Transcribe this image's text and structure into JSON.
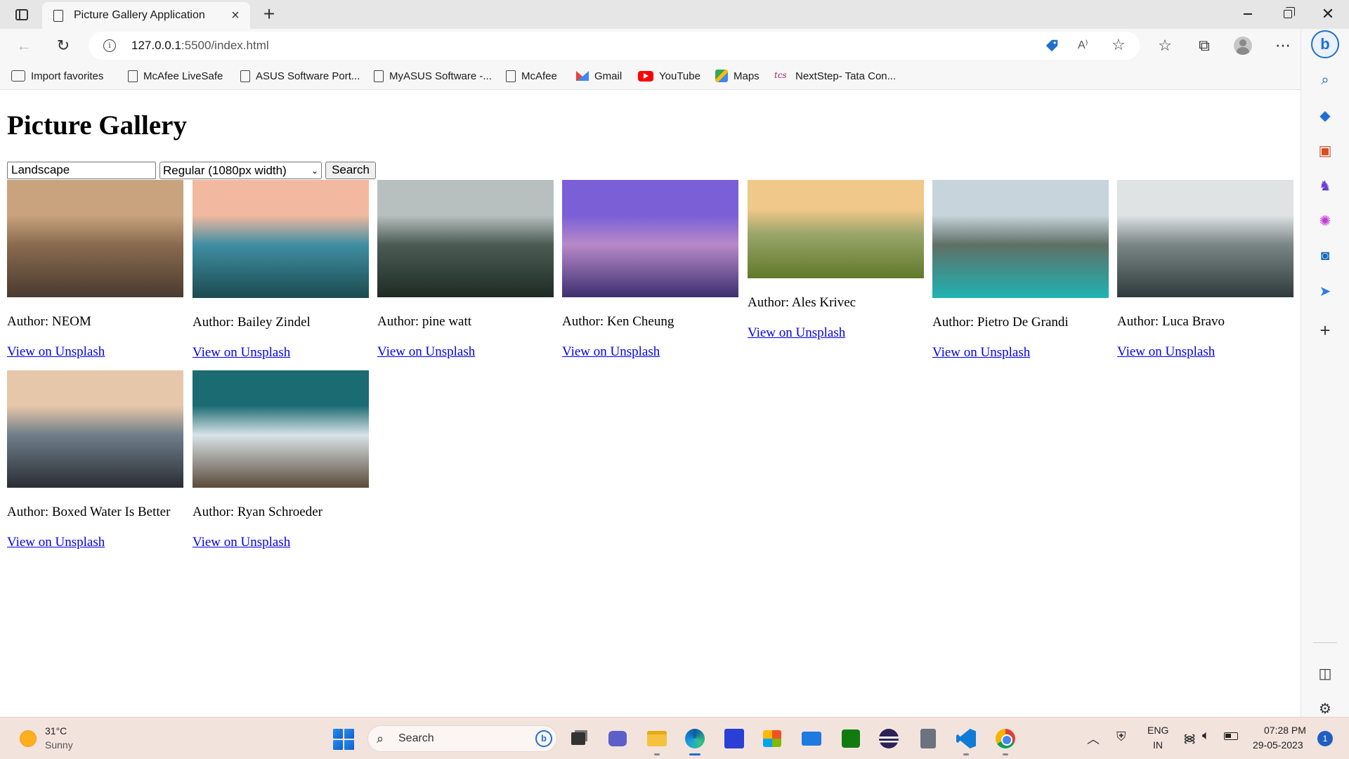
{
  "browser": {
    "tab_title": "Picture Gallery Application",
    "url_host": "127.0.0.1",
    "url_rest": ":5500/index.html",
    "favorites": [
      {
        "label": "Import favorites",
        "icon": "import-icon"
      },
      {
        "label": "McAfee LiveSafe",
        "icon": "page-icon"
      },
      {
        "label": "ASUS Software Port...",
        "icon": "page-icon"
      },
      {
        "label": "MyASUS Software -...",
        "icon": "page-icon"
      },
      {
        "label": "McAfee",
        "icon": "page-icon"
      },
      {
        "label": "Gmail",
        "icon": "gmail-icon"
      },
      {
        "label": "YouTube",
        "icon": "youtube-icon"
      },
      {
        "label": "Maps",
        "icon": "maps-icon"
      },
      {
        "label": "NextStep- Tata Con...",
        "icon": "tcs-icon"
      }
    ],
    "tcs_glyph": "tcs"
  },
  "page": {
    "title": "Picture Gallery",
    "query_value": "Landscape",
    "size_selected": "Regular (1080px width)",
    "search_label": "Search",
    "link_label": "View on Unsplash",
    "photos": [
      {
        "author": "Author: NEOM",
        "palette": [
          "#c9a37e",
          "#8a6b4f",
          "#4a3a30"
        ]
      },
      {
        "author": "Author: Bailey Zindel",
        "palette": [
          "#f2b8a0",
          "#3f8ea3",
          "#1c4a4f"
        ]
      },
      {
        "author": "Author: pine watt",
        "palette": [
          "#b8c0bf",
          "#4c5c55",
          "#1e2a25"
        ]
      },
      {
        "author": "Author: Ken Cheung",
        "palette": [
          "#7a5fd6",
          "#b889c9",
          "#3d2f6e"
        ]
      },
      {
        "author": "Author: Ales Krivec",
        "palette": [
          "#f0c889",
          "#9aa56b",
          "#5f7a2a"
        ]
      },
      {
        "author": "Author: Pietro De Grandi",
        "palette": [
          "#c7d4db",
          "#5f6f66",
          "#1fb3b3"
        ]
      },
      {
        "author": "Author: Luca Bravo",
        "palette": [
          "#dfe3e4",
          "#7b8686",
          "#2f3a3c"
        ]
      },
      {
        "author": "Author: Boxed Water Is Better",
        "palette": [
          "#e7c7a9",
          "#6f7e8a",
          "#2a2d33"
        ]
      },
      {
        "author": "Author: Ryan Schroeder",
        "palette": [
          "#1b6b73",
          "#d8e3e7",
          "#5b4a3a"
        ]
      }
    ]
  },
  "taskbar": {
    "weather_temp": "31°C",
    "weather_desc": "Sunny",
    "search_placeholder": "Search",
    "lang_line1": "ENG",
    "lang_line2": "IN",
    "time": "07:28 PM",
    "date": "29-05-2023",
    "notifications": "1"
  }
}
